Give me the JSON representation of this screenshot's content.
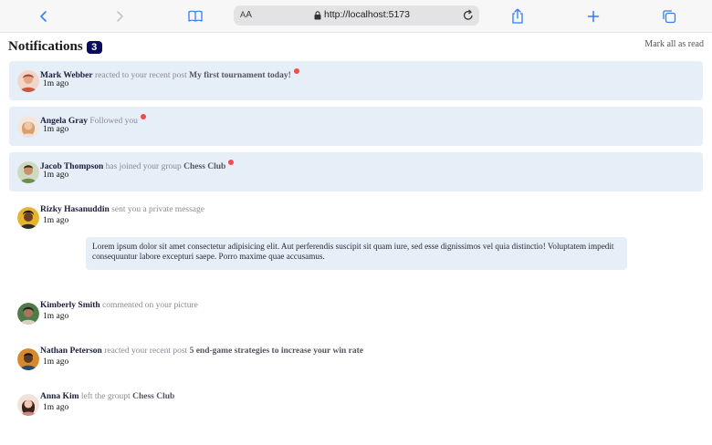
{
  "browser": {
    "text_size_label_small": "A",
    "text_size_label_big": "A",
    "url": "http://localhost:5173"
  },
  "header": {
    "title": "Notifications",
    "count": "3",
    "mark_all": "Mark all as read"
  },
  "notifications": [
    {
      "user": "Mark Webber",
      "action": "reacted to your recent post",
      "target": "My first tournament today!",
      "time": "1m ago",
      "unread": true,
      "avatar_color": "#c55a3a"
    },
    {
      "user": "Angela Gray",
      "action": "Followed you",
      "target": "",
      "time": "1m ago",
      "unread": true,
      "avatar_color": "#d9a06b"
    },
    {
      "user": "Jacob Thompson",
      "action": "has joined your group",
      "target": "Chess Club",
      "time": "1m ago",
      "unread": true,
      "avatar_color": "#6b8e4e"
    },
    {
      "user": "Rizky Hasanuddin",
      "action": "sent you a private message",
      "target": "",
      "time": "1m ago",
      "unread": false,
      "avatar_color": "#e7b52c",
      "message": "Lorem ipsum dolor sit amet consectetur adipisicing elit. Aut perferendis suscipit sit quam iure, sed esse dignissimos vel quia distinctio! Voluptatem impedit consequuntur labore excepturi saepe. Porro maxime quae accusamus."
    },
    {
      "user": "Kimberly Smith",
      "action": "commented on your picture",
      "target": "",
      "time": "1m ago",
      "unread": false,
      "avatar_color": "#4f7a4a"
    },
    {
      "user": "Nathan Peterson",
      "action": "reacted your recent post",
      "target": "5 end-game strategies to increase your win rate",
      "time": "1m ago",
      "unread": false,
      "avatar_color": "#d68a2c"
    },
    {
      "user": "Anna Kim",
      "action": "left the groupt",
      "target": "Chess Club",
      "time": "1m ago",
      "unread": false,
      "avatar_color": "#c98b7a"
    }
  ]
}
